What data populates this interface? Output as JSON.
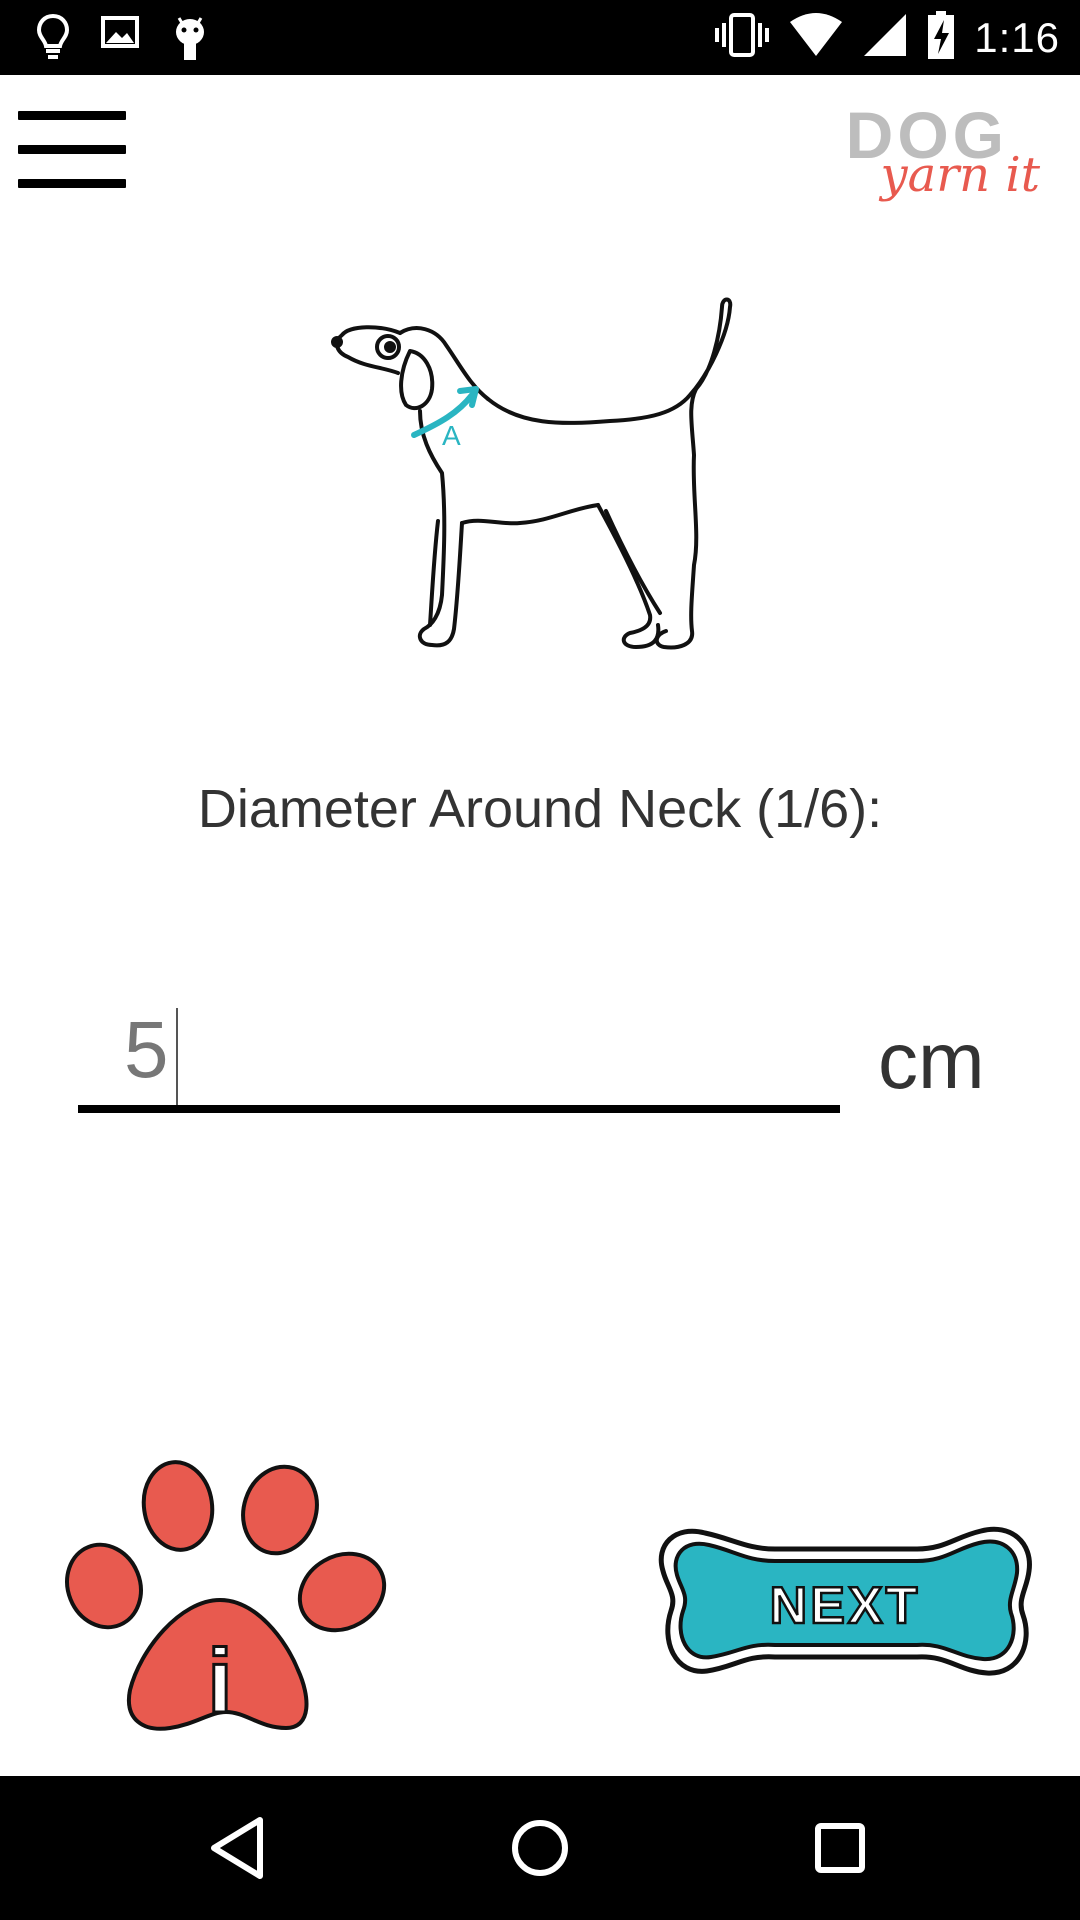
{
  "status_bar": {
    "time": "1:16",
    "left_icons": [
      "lightbulb-icon",
      "image-icon",
      "android-icon"
    ],
    "right_icons": [
      "vibrate-icon",
      "wifi-icon",
      "signal-icon",
      "battery-charging-icon"
    ]
  },
  "header": {
    "logo_dog": "DOG",
    "logo_yarn": "yarn it"
  },
  "measurement": {
    "label": "Diameter Around Neck (1/6):",
    "value": "5",
    "unit": "cm",
    "marker": "A"
  },
  "actions": {
    "info_label": "i",
    "next_label": "NEXT"
  },
  "colors": {
    "accent_red": "#e85a4f",
    "accent_teal": "#2ab5c2",
    "logo_gray": "#bdbdbd"
  }
}
